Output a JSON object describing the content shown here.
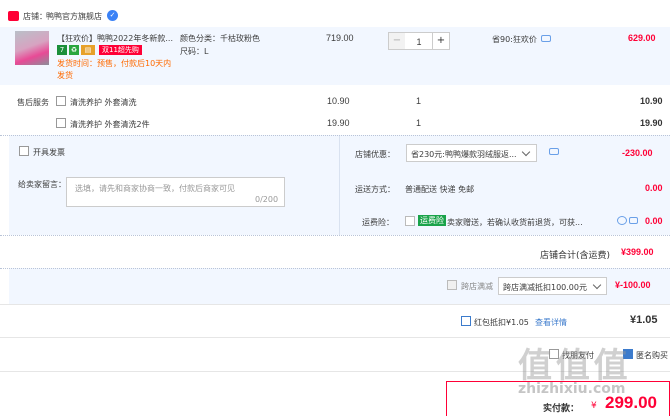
{
  "shop": {
    "label": "店铺：",
    "name": "鸭鸭官方旗舰店",
    "badge": "✓"
  },
  "item": {
    "title_line1": "【狂欢价】鸭鸭2022年冬新款...",
    "promo_tag": "双11超先购",
    "tag_icons": [
      "7",
      "♻",
      "▤"
    ],
    "ship_line1": "发货时间：预售，付款后10天内",
    "ship_line2": "发货",
    "sku_color": "颜色分类：千枯玫粉色",
    "sku_size": "尺码：L",
    "price": "719.00",
    "qty": "1",
    "minus": "−",
    "plus": "+",
    "saving": "省90:狂欢价",
    "subtotal": "629.00"
  },
  "aftersale": {
    "label": "售后服务",
    "options": [
      {
        "name": "清洗养护 外套清洗",
        "price": "10.90",
        "qty": "1",
        "total": "10.90"
      },
      {
        "name": "清洗养护 外套清洗2件",
        "price": "19.90",
        "qty": "1",
        "total": "19.90"
      }
    ]
  },
  "invoice": {
    "label": "开具发票"
  },
  "message": {
    "label": "给卖家留言：",
    "placeholder": "选填，请先和商家协商一致，付款后商家可见",
    "counter": "0/200"
  },
  "shop_coupon": {
    "label": "店铺优惠：",
    "value": "省230元:鸭鸭爆款羽绒服返...",
    "amount": "-230.00"
  },
  "delivery": {
    "label": "运送方式：",
    "value": "普通配送 快递 免邮",
    "amount": "0.00"
  },
  "shipping_insurance": {
    "label": "运费险：",
    "tag": "运费险",
    "desc": "卖家赠送，若确认收货前退货，可获...",
    "amount": "0.00"
  },
  "shop_total": {
    "label": "店铺合计(含运费)",
    "amount": "¥399.00"
  },
  "cross_shop": {
    "label": "跨店满减",
    "value": "跨店满减抵扣100.00元",
    "amount": "¥-100.00"
  },
  "red_packet": {
    "label": "红包抵扣¥1.05",
    "link": "查看详情",
    "amount": "¥1.05"
  },
  "footer": {
    "pay_with_friend": "找朋友付",
    "anonymous": "匿名购买",
    "actual_label": "实付款：",
    "currency": "¥",
    "actual_amount": "299.00"
  },
  "watermark": {
    "text": "值 值 值",
    "domain": "zhizhixiu.com"
  },
  "colors": {
    "accent": "#ff0036",
    "blue_panel": "#f2f7ff",
    "link": "#3c7bcc"
  }
}
